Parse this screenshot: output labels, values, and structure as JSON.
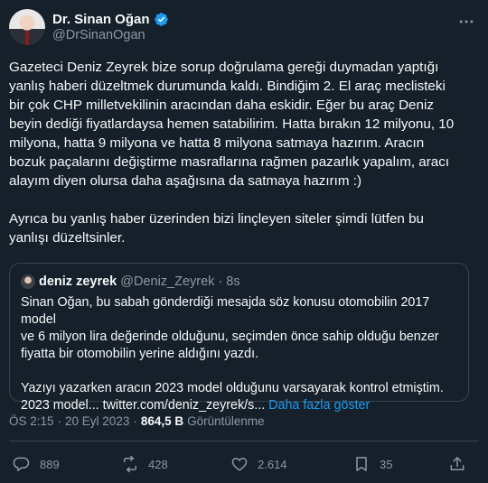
{
  "author": {
    "display_name": "Dr. Sinan Oğan",
    "handle": "@DrSinanOgan"
  },
  "tweet_text": "Gazeteci Deniz Zeyrek bize sorup doğrulama gereği duymadan yaptığı\nyanlış haberi düzeltmek durumunda kaldı. Bindiğim 2. El araç meclisteki\nbir çok CHP milletvekilinin aracından daha eskidir. Eğer bu araç Deniz\nbeyin dediği fiyatlardaysa hemen satabilirim. Hatta bırakın 12 milyonu, 10\nmilyona, hatta 9 milyona ve hatta 8 milyona satmaya hazırım. Aracın\nbozuk paçalarını değiştirme masraflarına rağmen pazarlık yapalım, aracı\nalayım diyen olursa daha aşağısına da satmaya hazırım :)\n\nAyrıca bu yanlış haber üzerinden bizi linçleyen siteler şimdi lütfen bu\nyanlışı düzeltsinler.",
  "quote": {
    "display_name": "deniz zeyrek",
    "handle": "@Deniz_Zeyrek",
    "separator": "·",
    "time": "8s",
    "text": "Sinan Oğan, bu sabah gönderdiği mesajda söz konusu otomobilin 2017 model\nve 6 milyon lira değerinde olduğunu, seçimden önce sahip olduğu benzer\nfiyatta bir otomobilin yerine aldığını yazdı.\n\nYazıyı yazarken aracın 2023 model olduğunu varsayarak kontrol etmiştim.\n2023 model... twitter.com/deniz_zeyrek/s...",
    "show_more": "Daha fazla göster"
  },
  "meta": {
    "time": "ÖS 2:15",
    "dot1": "·",
    "date": "20 Eyl 2023",
    "dot2": "·",
    "views": "864,5 B",
    "views_label": "Görüntülenme"
  },
  "actions": {
    "replies": "889",
    "retweets": "428",
    "likes": "2.614",
    "bookmarks": "35"
  },
  "colors": {
    "background": "#15202b",
    "accent": "#1d9bf0",
    "secondary_text": "#8b98a5",
    "border": "#38444d"
  }
}
